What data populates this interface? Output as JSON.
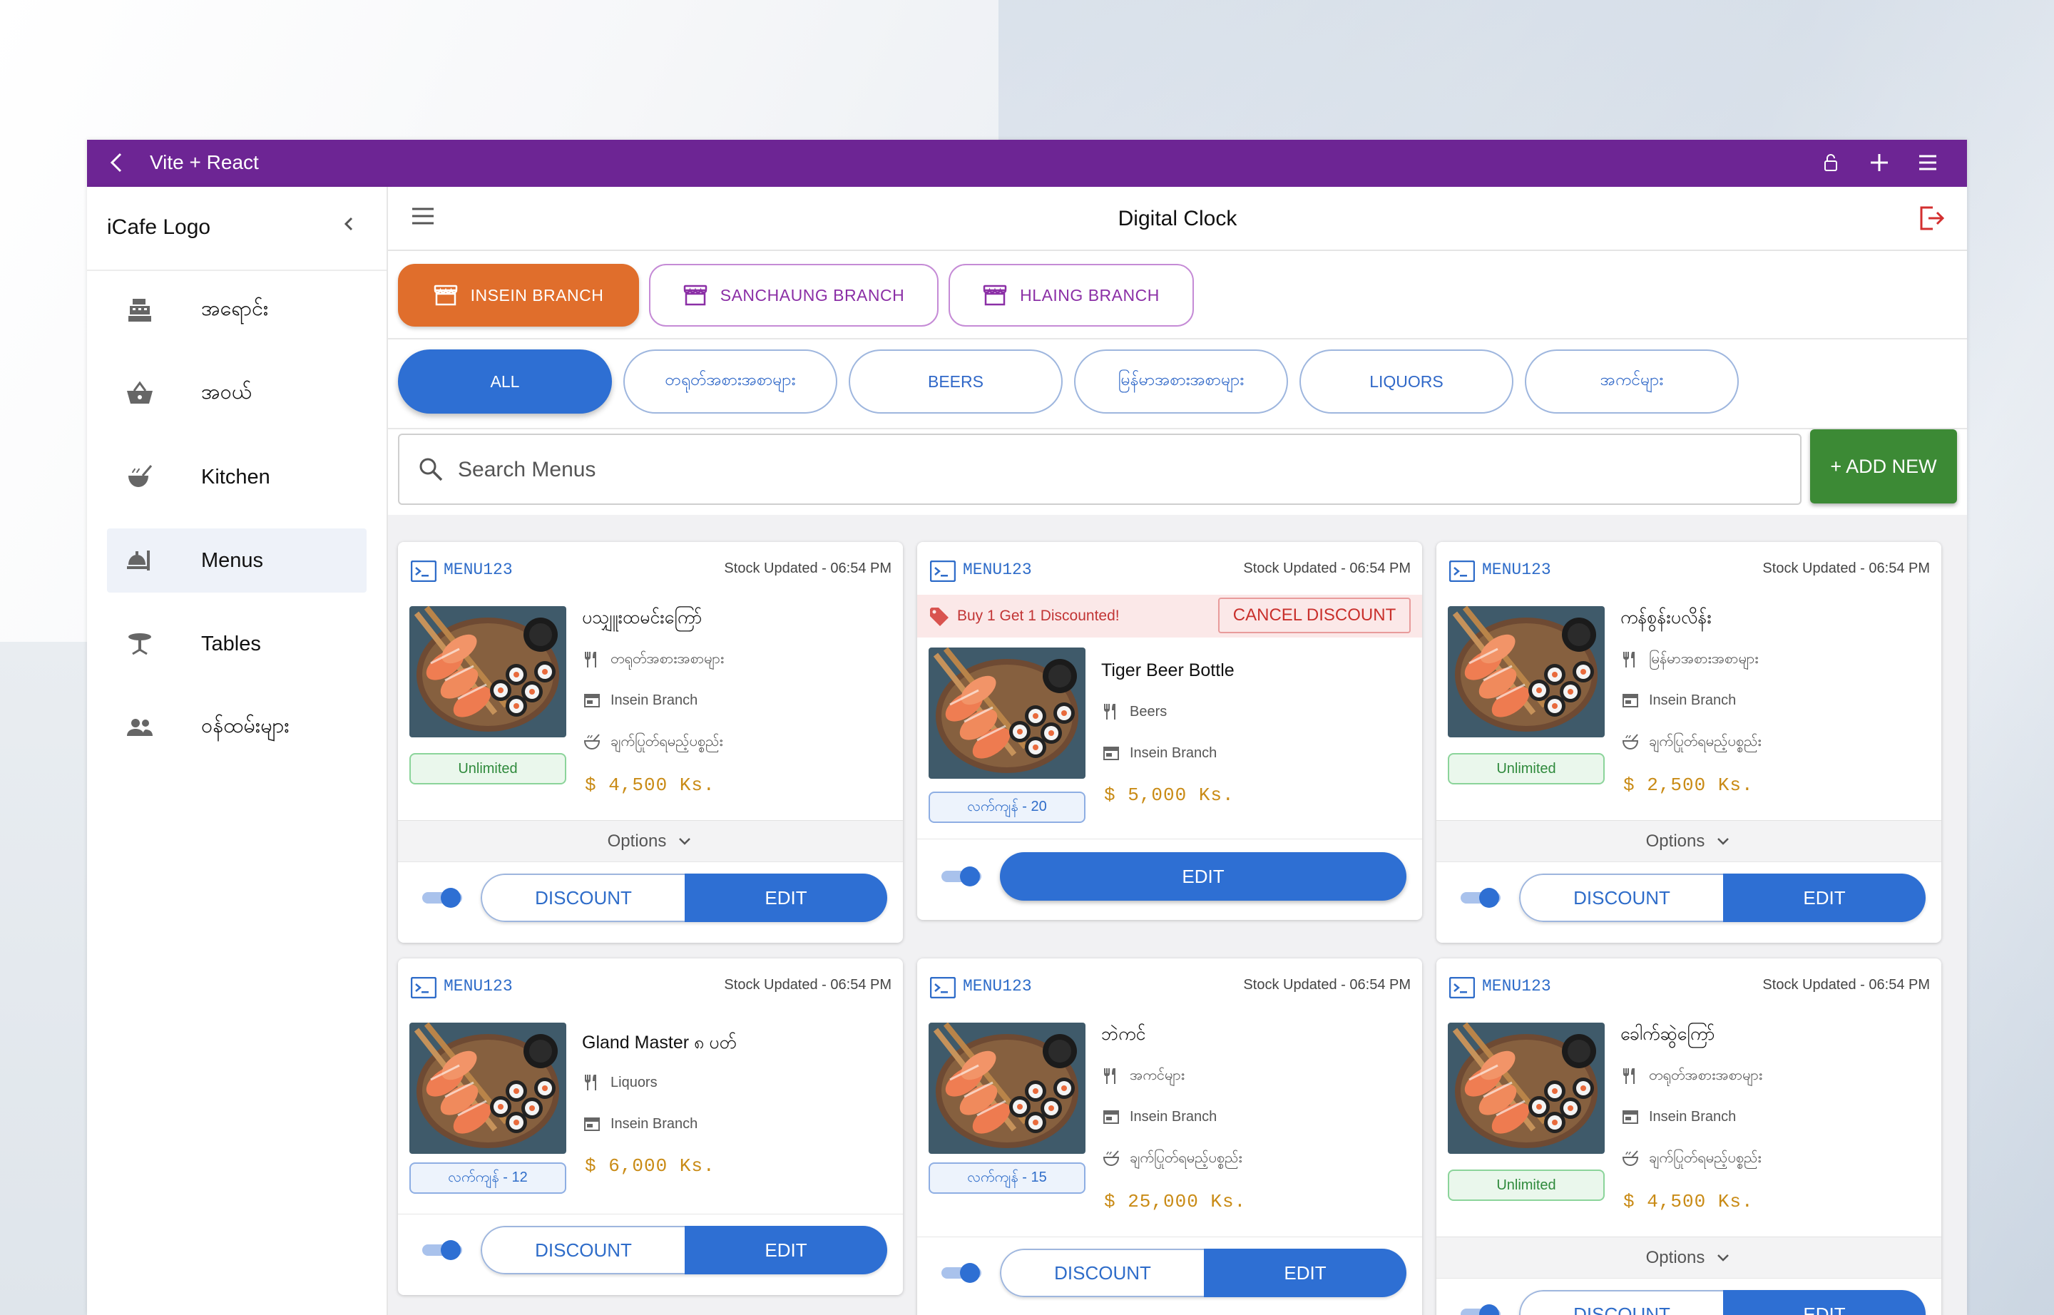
{
  "window": {
    "title": "Vite + React"
  },
  "sidebar": {
    "logo": "iCafe Logo",
    "items": [
      {
        "label": "အရောင်း",
        "icon": "cash-register-icon",
        "active": false
      },
      {
        "label": "အဝယ်",
        "icon": "basket-icon",
        "active": false
      },
      {
        "label": "Kitchen",
        "icon": "soup-kitchen-icon",
        "active": false
      },
      {
        "label": "Menus",
        "icon": "room-service-icon",
        "active": true
      },
      {
        "label": "Tables",
        "icon": "table-icon",
        "active": false
      },
      {
        "label": "ဝန်ထမ်းများ",
        "icon": "people-icon",
        "active": false
      }
    ]
  },
  "topbar": {
    "title": "Digital Clock"
  },
  "branches": [
    {
      "label": "INSEIN BRANCH",
      "active": true
    },
    {
      "label": "SANCHAUNG BRANCH",
      "active": false
    },
    {
      "label": "HLAING BRANCH",
      "active": false
    }
  ],
  "categories": [
    {
      "label": "ALL",
      "active": true
    },
    {
      "label": "တရုတ်အစားအစာများ",
      "active": false
    },
    {
      "label": "BEERS",
      "active": false
    },
    {
      "label": "မြန်မာအစားအစာများ",
      "active": false
    },
    {
      "label": "LIQUORS",
      "active": false
    },
    {
      "label": "အကင်များ",
      "active": false
    }
  ],
  "search": {
    "placeholder": "Search Menus",
    "value": ""
  },
  "add_new_label": "+ ADD NEW",
  "common": {
    "options_label": "Options",
    "discount_label": "DISCOUNT",
    "edit_label": "EDIT"
  },
  "cards": [
    {
      "id": "MENU123",
      "stock_updated": "Stock Updated - 06:54 PM",
      "name": "ပသျှူးထမင်းကြော်",
      "category": "တရုတ်အစားအစာများ",
      "branch": "Insein Branch",
      "kitchen": "ချက်ပြုတ်ရမည့်ပစ္စည်း",
      "price": "$ 4,500 Ks.",
      "stock": "Unlimited",
      "toggle_on": true
    },
    {
      "id": "MENU123",
      "stock_updated": "Stock Updated - 06:54 PM",
      "promo": "Buy 1 Get 1 Discounted!",
      "cancel_label": "CANCEL DISCOUNT",
      "name": "Tiger Beer Bottle",
      "category": "Beers",
      "branch": "Insein Branch",
      "price": "$ 5,000 Ks.",
      "stock": "လက်ကျန် - 20",
      "toggle_on": true
    },
    {
      "id": "MENU123",
      "stock_updated": "Stock Updated - 06:54 PM",
      "name": "ကန်စွန်းပလိန်း",
      "category": "မြန်မာအစားအစာများ",
      "branch": "Insein Branch",
      "kitchen": "ချက်ပြုတ်ရမည့်ပစ္စည်း",
      "price": "$ 2,500 Ks.",
      "stock": "Unlimited",
      "toggle_on": true
    },
    {
      "id": "MENU123",
      "stock_updated": "Stock Updated - 06:54 PM",
      "name": "Gland Master ၈ ပတ်",
      "category": "Liquors",
      "branch": "Insein Branch",
      "price": "$ 6,000 Ks.",
      "stock": "လက်ကျန် - 12",
      "toggle_on": true
    },
    {
      "id": "MENU123",
      "stock_updated": "Stock Updated - 06:54 PM",
      "name": "ဘဲကင်",
      "category": "အကင်များ",
      "branch": "Insein Branch",
      "kitchen": "ချက်ပြုတ်ရမည့်ပစ္စည်း",
      "price": "$ 25,000 Ks.",
      "stock": "လက်ကျန် - 15",
      "toggle_on": true
    },
    {
      "id": "MENU123",
      "stock_updated": "Stock Updated - 06:54 PM",
      "name": "ခေါက်ဆွဲကြော်",
      "category": "တရုတ်အစားအစာများ",
      "branch": "Insein Branch",
      "kitchen": "ချက်ပြုတ်ရမည့်ပစ္စည်း",
      "price": "$ 4,500 Ks.",
      "stock": "Unlimited",
      "toggle_on": true
    }
  ],
  "colors": {
    "titlebar": "#6d2594",
    "accent_blue": "#2e6fd3",
    "branch_active": "#e06e2c",
    "add_new": "#3c8a35",
    "price": "#c98b16"
  }
}
